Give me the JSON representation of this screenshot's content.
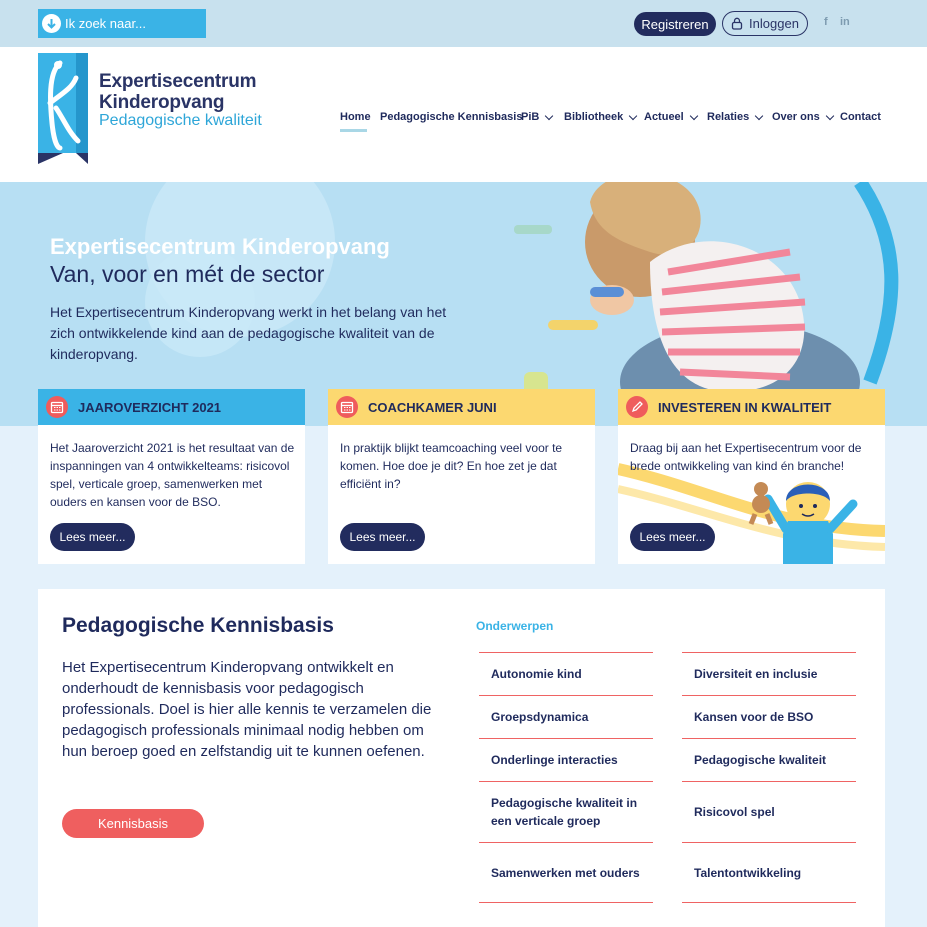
{
  "topbar": {
    "search_placeholder": "Ik zoek naar...",
    "register_label": "Registreren",
    "login_label": "Inloggen",
    "facebook": "f",
    "linkedin": "in"
  },
  "brand": {
    "line1": "Expertisecentrum",
    "line2": "Kinderopvang",
    "line3": "Pedagogische kwaliteit"
  },
  "nav": {
    "items": [
      {
        "label": "Home"
      },
      {
        "label": "Pedagogische Kennisbasis"
      },
      {
        "label": "PiB"
      },
      {
        "label": "Bibliotheek"
      },
      {
        "label": "Actueel"
      },
      {
        "label": "Relaties"
      },
      {
        "label": "Over ons"
      },
      {
        "label": "Contact"
      }
    ]
  },
  "hero": {
    "title": "Expertisecentrum Kinderopvang",
    "subtitle": "Van, voor en mét de sector",
    "text": "Het Expertisecentrum Kinderopvang werkt in het belang van het zich ontwikkelende kind aan de pedagogische kwaliteit van de kinderopvang."
  },
  "cards": [
    {
      "title": "JAAROVERZICHT 2021",
      "text": "Het Jaaroverzicht 2021 is het resultaat van de inspanningen van 4 ontwikkelteams: risicovol spel, verticale groep, samenwerken met ouders en kansen voor de BSO.",
      "button": "Lees meer...",
      "header_color": "#3ab3e6"
    },
    {
      "title": "COACHKAMER JUNI",
      "text": "In praktijk blijkt teamcoaching veel voor te komen. Hoe doe je dit? En hoe zet je dat efficiënt in?",
      "button": "Lees meer...",
      "header_color": "#fcd870"
    },
    {
      "title": "INVESTEREN IN KWALITEIT",
      "text": "Draag bij aan het Expertisecentrum voor de brede ontwikkeling van kind én branche!",
      "button": "Lees meer...",
      "header_color": "#fcd870"
    }
  ],
  "kennisbasis": {
    "title": "Pedagogische Kennisbasis",
    "text": "Het Expertisecentrum Kinderopvang ontwikkelt en onderhoudt de kennisbasis voor pedagogisch professionals. Doel is hier alle kennis te verzamelen die pedagogisch professionals minimaal nodig hebben om hun beroep goed en zelfstandig uit te kunnen oefenen.",
    "button": "Kennisbasis",
    "topics_label": "Onderwerpen",
    "topics_left": [
      "Autonomie kind",
      "Groepsdynamica",
      "Onderlinge interacties",
      "Pedagogische kwaliteit in een verticale groep",
      "Samenwerken met ouders"
    ],
    "topics_right": [
      "Diversiteit en inclusie",
      "Kansen voor de BSO",
      "Pedagogische kwaliteit",
      "Risicovol spel",
      "Talentontwikkeling"
    ]
  },
  "colors": {
    "navy": "#1f2a5c",
    "sky": "#3ab3e6",
    "coral": "#ef5f5f",
    "yellow": "#fcd870"
  }
}
